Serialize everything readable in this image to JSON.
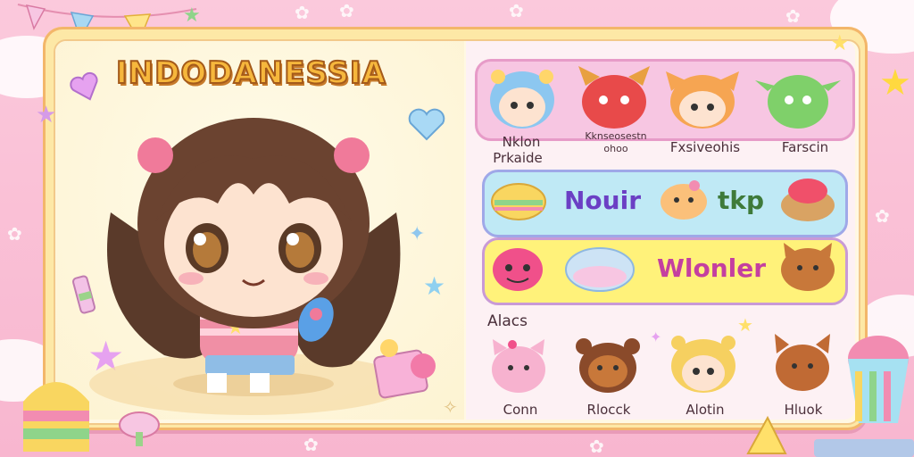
{
  "game": {
    "title": "INDODANESSIA"
  },
  "roster_top": {
    "labels": [
      "Nklon",
      "Prkaide",
      "Kknseosestn",
      "ohoo",
      "Fxsiveohis",
      "Farscin"
    ]
  },
  "banner_rows": {
    "row1_text": "Nouir",
    "row1_text2": "tkp",
    "row2_text": "Wlonler"
  },
  "roster_bottom": {
    "heading": "Alacs",
    "labels": [
      "Conn",
      "Rlocck",
      "Alotin",
      "Hluok"
    ]
  },
  "colors": {
    "title_fill": "#f6b73c",
    "row1_bg": "#f7c6e2",
    "row2_bg": "#bfe9f5",
    "row3_bg": "#fff27a",
    "accent_pink": "#e79bc8"
  }
}
